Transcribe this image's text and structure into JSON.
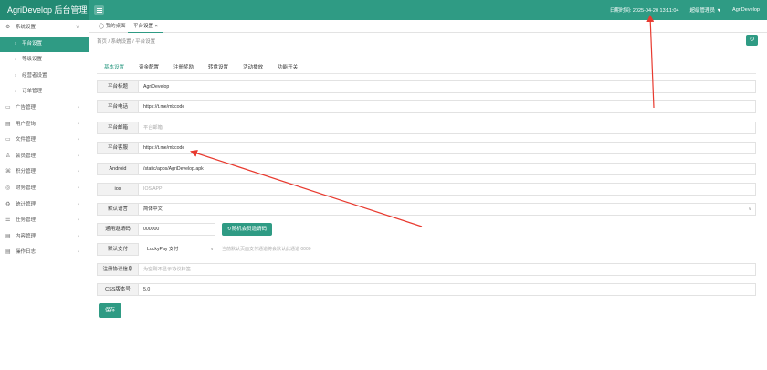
{
  "app": {
    "title": "AgriDevelop 后台管理"
  },
  "topbar": {
    "time_label": "日期时间: 2025-04-20 13:11:04",
    "admin_label": "超级管理员 ▼",
    "user_name": "AgriDevelop"
  },
  "sidebar": {
    "items": [
      {
        "icon": "⚙",
        "label": "系统设置",
        "arrow": "∨"
      },
      {
        "icon": "›",
        "label": "平台设置",
        "active": true
      },
      {
        "icon": "›",
        "label": "等级设置"
      },
      {
        "icon": "›",
        "label": "经营者设置"
      },
      {
        "icon": "›",
        "label": "订单管理"
      },
      {
        "icon": "▭",
        "label": "广告管理",
        "arrow": "‹"
      },
      {
        "icon": "▤",
        "label": "用户查询",
        "arrow": "‹"
      },
      {
        "icon": "▭",
        "label": "文件管理",
        "arrow": "‹"
      },
      {
        "icon": "♙",
        "label": "会员管理",
        "arrow": "‹"
      },
      {
        "icon": "⌘",
        "label": "积分管理",
        "arrow": "‹"
      },
      {
        "icon": "◎",
        "label": "财务管理",
        "arrow": "‹"
      },
      {
        "icon": "♻",
        "label": "统计管理",
        "arrow": "‹"
      },
      {
        "icon": "☰",
        "label": "任务管理",
        "arrow": "‹"
      },
      {
        "icon": "▤",
        "label": "内容管理",
        "arrow": "‹"
      },
      {
        "icon": "▤",
        "label": "操作日志",
        "arrow": "‹"
      }
    ]
  },
  "tabs": [
    {
      "label": "◯ 我的桌面"
    },
    {
      "label": "平台设置  ×",
      "active": true
    }
  ],
  "breadcrumb": "首页  /  系统设置  /  平台设置",
  "subtabs": [
    "基本设置",
    "资金配置",
    "注册奖励",
    "转盘设置",
    "活动播放",
    "功能开关"
  ],
  "form": {
    "site_name": {
      "label": "平台标题",
      "value": "AgriDevelop"
    },
    "phone": {
      "label": "平台电话",
      "value": "https://t.me/mkcode"
    },
    "domain": {
      "label": "平台邮箱",
      "placeholder": "平台邮箱"
    },
    "service": {
      "label": "平台客服",
      "value": "https://t.me/mkcode"
    },
    "android": {
      "label": "Android",
      "value": "/static/apps/AgriDevelop.apk"
    },
    "ios": {
      "label": "ios",
      "placeholder": "IOS APP"
    },
    "lang": {
      "label": "默认语言",
      "value": "简体中文"
    },
    "invite": {
      "label": "通用邀请码",
      "value": "000000",
      "button": "↻随机会员邀请码"
    },
    "payment": {
      "label": "默认支付",
      "value": "LuckyPay 支付",
      "hint": "当前默认页面支付通道将会默认此通道 0000"
    },
    "reg_info": {
      "label": "注册协议信息",
      "placeholder": "为空则不显示协议标签"
    },
    "css_version": {
      "label": "CSS版本号",
      "value": "5.0"
    }
  },
  "save_label": "保存",
  "colors": {
    "brand": "#2f9b84",
    "annotation_arrow": "#e83a2f"
  }
}
